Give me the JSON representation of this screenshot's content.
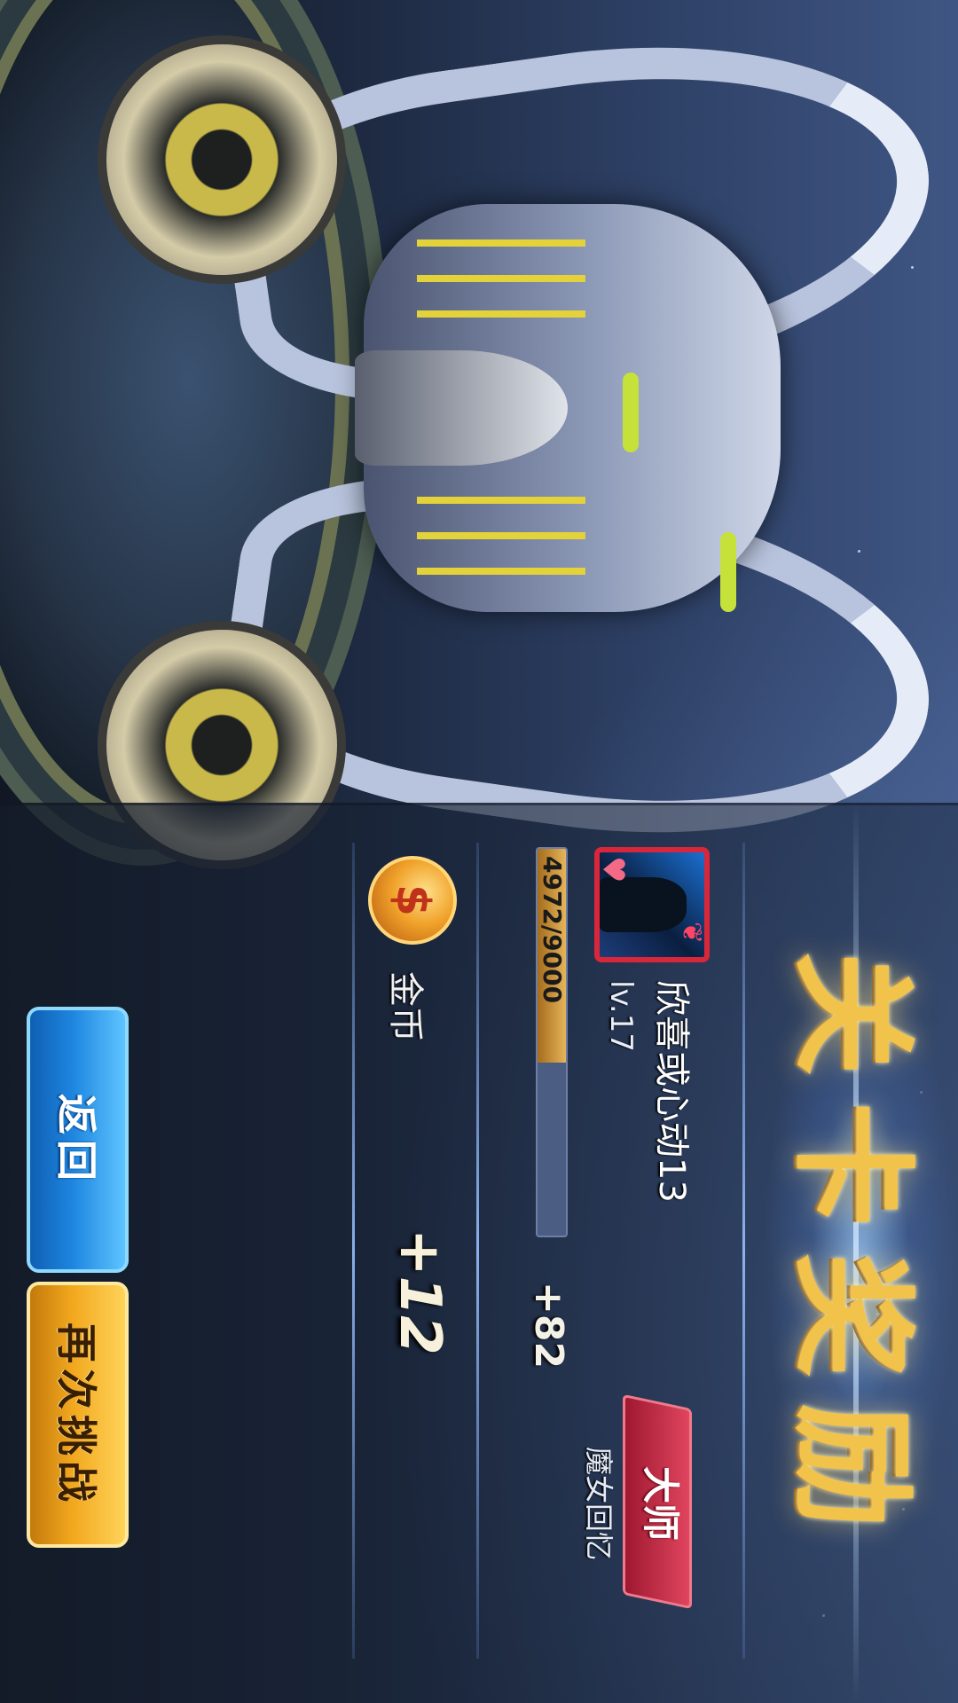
{
  "screen": {
    "title": "关卡奖励"
  },
  "player": {
    "name": "欣喜或心动13",
    "level": "lv.17",
    "rank_badge": "大师",
    "rank_subtitle": "魔女回忆"
  },
  "experience": {
    "progress_text": "4972/9000",
    "current": 4972,
    "max": 9000,
    "gain": "+82"
  },
  "gold": {
    "label": "金币",
    "gain": "+12",
    "coin_glyph": "$"
  },
  "buttons": {
    "back_label": "返回",
    "retry_label": "再次挑战"
  },
  "colors": {
    "title_gold": "#f2c34a",
    "back_blue": "#1e86e0",
    "retry_orange": "#f2a81e",
    "rank_red": "#c02a44"
  }
}
